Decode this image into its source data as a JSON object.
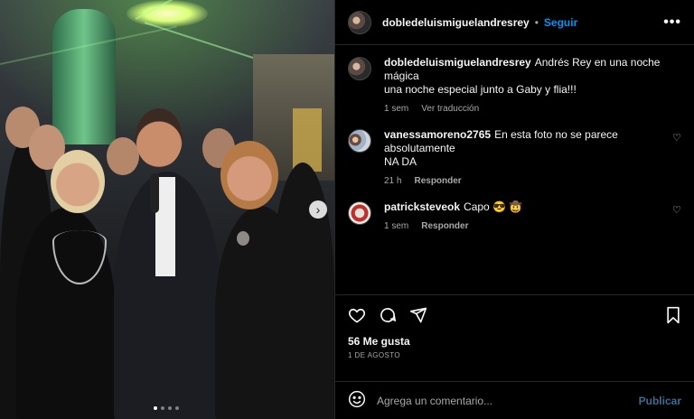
{
  "post": {
    "username": "dobledeluismiguelandresrey",
    "follow_label": "Seguir",
    "separator": "•",
    "more_label": "•••"
  },
  "caption": {
    "username": "dobledeluismiguelandresrey",
    "text_line1": "Andrés Rey en una noche mágica",
    "text_line2": "una noche especial junto a Gaby y flia!!!",
    "time": "1 sem",
    "translate_label": "Ver traducción"
  },
  "comments": [
    {
      "username": "vanessamoreno2765",
      "text_line1": "En esta foto no se parece absolutamente",
      "text_line2": "NA DA",
      "time": "21 h",
      "reply_label": "Responder"
    },
    {
      "username": "patrickstevеok",
      "text": "Capo 😎 🤠",
      "time": "1 sem",
      "reply_label": "Responder"
    }
  ],
  "footer": {
    "likes": "56 Me gusta",
    "date": "1 DE AGOSTO",
    "comment_placeholder": "Agrega un comentario...",
    "publish_label": "Publicar"
  },
  "icons": {
    "like": "heart-icon",
    "comment": "comment-icon",
    "share": "share-icon",
    "save": "bookmark-icon",
    "emoji": "emoji-icon",
    "next": "chevron-right-icon"
  },
  "colors": {
    "background": "#000000",
    "accent": "#0095f6",
    "publish_disabled": "#3a6c93",
    "muted": "#a8a8a8"
  }
}
